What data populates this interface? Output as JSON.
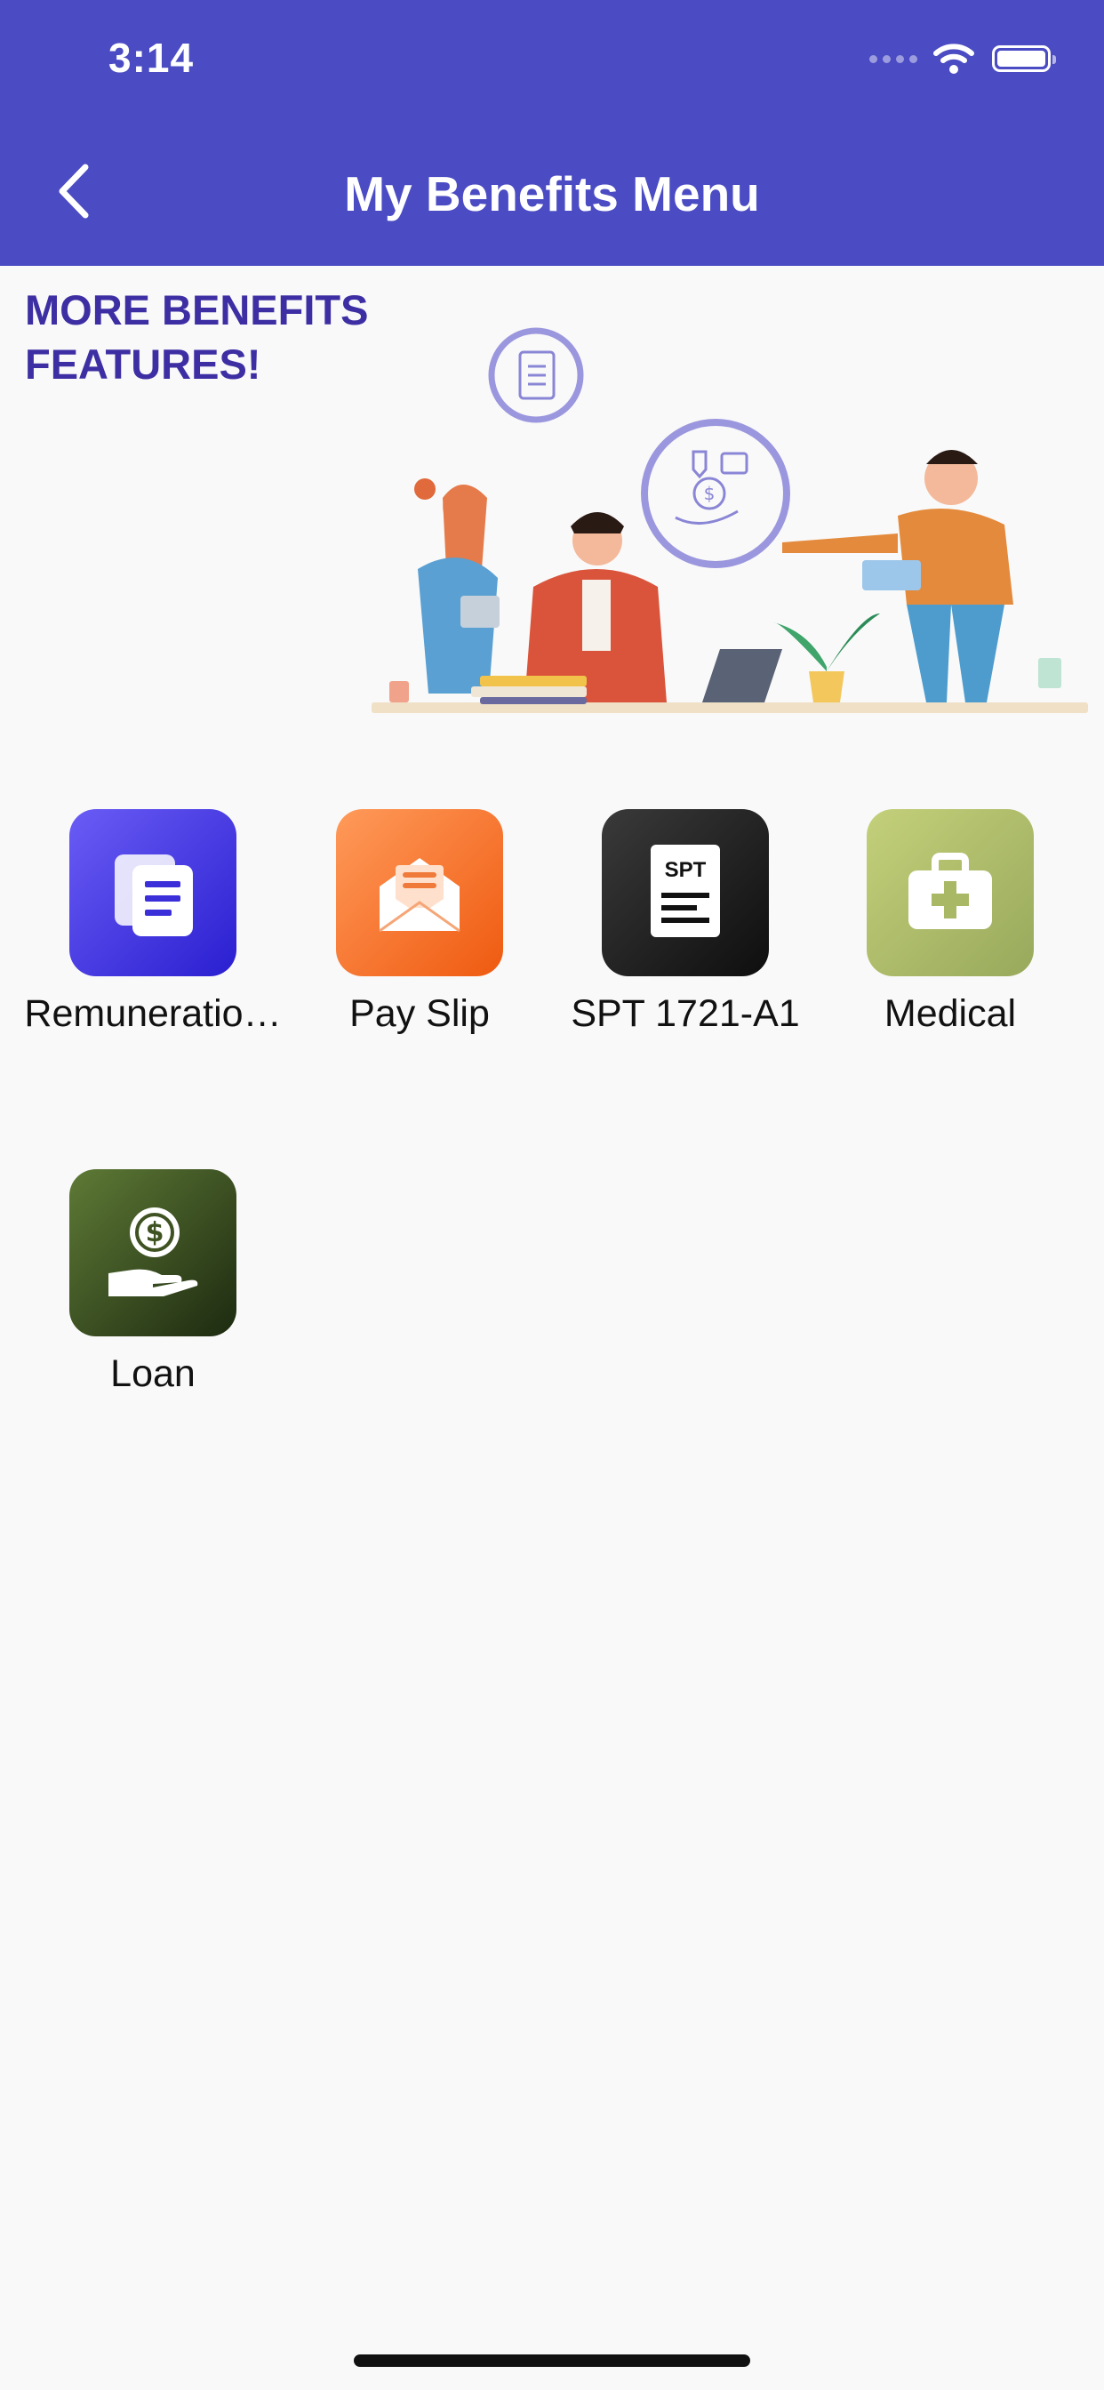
{
  "status_bar": {
    "time": "3:14"
  },
  "header": {
    "title": "My Benefits Menu",
    "back_icon": "chevron-left-icon"
  },
  "banner": {
    "line1": "MORE BENEFITS",
    "line2": "FEATURES!"
  },
  "menu": [
    {
      "label": "Remuneratio…",
      "icon": "documents-icon",
      "color_start": "#6a5cf5",
      "color_end": "#2a1fd0"
    },
    {
      "label": "Pay Slip",
      "icon": "envelope-icon",
      "color_start": "#ff9a5a",
      "color_end": "#ef5a10"
    },
    {
      "label": "SPT 1721-A1",
      "icon": "spt-document-icon",
      "icon_text": "SPT",
      "color_start": "#3a3a3a",
      "color_end": "#0e0e0e"
    },
    {
      "label": "Medical",
      "icon": "medical-kit-icon",
      "color_start": "#c4d07a",
      "color_end": "#98a95c"
    },
    {
      "label": "Loan",
      "icon": "hand-dollar-icon",
      "color_start": "#5e7a36",
      "color_end": "#1d2a10"
    }
  ]
}
